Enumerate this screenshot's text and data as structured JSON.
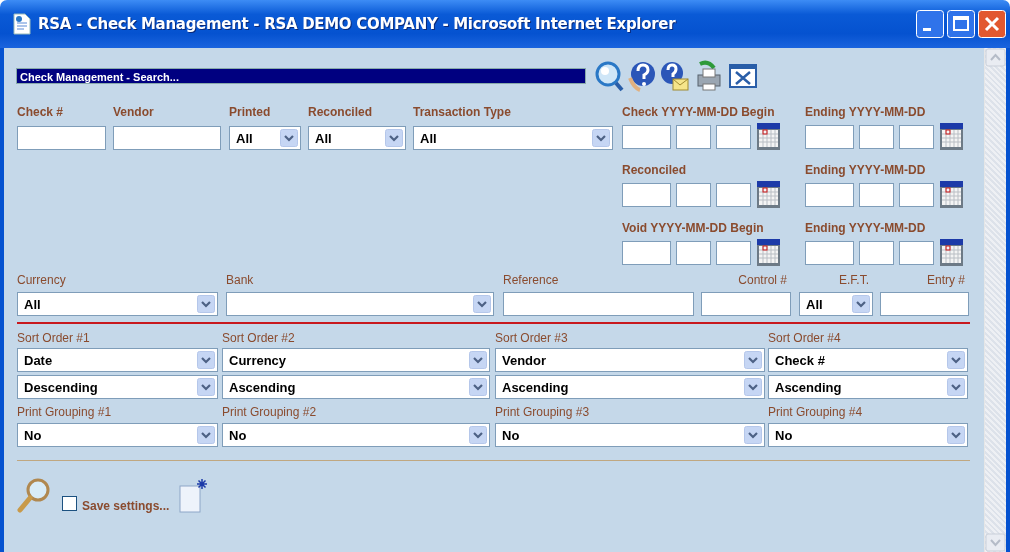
{
  "window": {
    "title": "RSA - Check Management - RSA DEMO COMPANY - Microsoft Internet Explorer"
  },
  "panel": {
    "title": "Check Management - Search..."
  },
  "filters": [
    {
      "label": "Check #",
      "kind": "text"
    },
    {
      "label": "Vendor",
      "kind": "text"
    },
    {
      "label": "Printed",
      "kind": "select",
      "value": "All"
    },
    {
      "label": "Reconciled",
      "kind": "select",
      "value": "All"
    },
    {
      "label": "Transaction Type",
      "kind": "select",
      "value": "All"
    }
  ],
  "date_ranges": [
    {
      "begin_label": "Check YYYY-MM-DD Begin",
      "end_label": "Ending YYYY-MM-DD"
    },
    {
      "begin_label": "Reconciled",
      "end_label": "Ending YYYY-MM-DD"
    },
    {
      "begin_label": "Void YYYY-MM-DD Begin",
      "end_label": "Ending YYYY-MM-DD"
    }
  ],
  "filters_2": [
    {
      "label": "Currency",
      "kind": "select",
      "value": "All"
    },
    {
      "label": "Bank",
      "kind": "select"
    },
    {
      "label": "Reference",
      "kind": "text"
    },
    {
      "label": "Control #",
      "kind": "text"
    },
    {
      "label": "E.F.T.",
      "kind": "select",
      "value": "All"
    },
    {
      "label": "Entry #",
      "kind": "text"
    }
  ],
  "sort_orders": [
    {
      "label": "Sort Order #1",
      "field": "Date",
      "direction": "Descending"
    },
    {
      "label": "Sort Order #2",
      "field": "Currency",
      "direction": "Ascending"
    },
    {
      "label": "Sort Order #3",
      "field": "Vendor",
      "direction": "Ascending"
    },
    {
      "label": "Sort Order #4",
      "field": "Check #",
      "direction": "Ascending"
    }
  ],
  "print_groupings": [
    {
      "label": "Print Grouping #1",
      "value": "No"
    },
    {
      "label": "Print Grouping #2",
      "value": "No"
    },
    {
      "label": "Print Grouping #3",
      "value": "No"
    },
    {
      "label": "Print Grouping #4",
      "value": "No"
    }
  ],
  "save_settings": {
    "label": "Save settings...",
    "checked": false
  }
}
